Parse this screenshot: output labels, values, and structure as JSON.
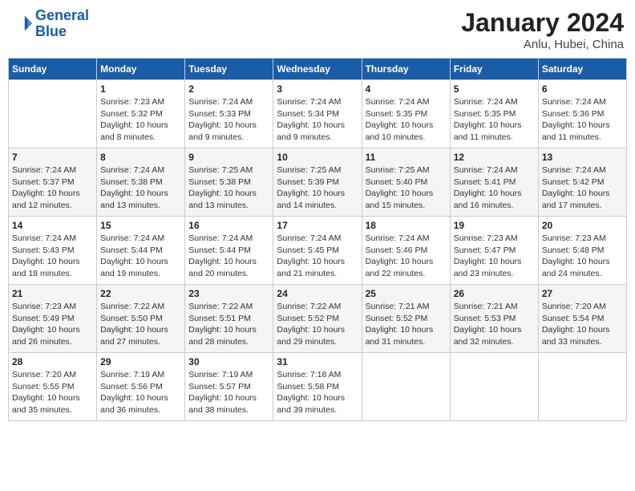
{
  "header": {
    "logo_line1": "General",
    "logo_line2": "Blue",
    "month": "January 2024",
    "location": "Anlu, Hubei, China"
  },
  "days_of_week": [
    "Sunday",
    "Monday",
    "Tuesday",
    "Wednesday",
    "Thursday",
    "Friday",
    "Saturday"
  ],
  "weeks": [
    [
      {
        "num": "",
        "sunrise": "",
        "sunset": "",
        "daylight": ""
      },
      {
        "num": "1",
        "sunrise": "Sunrise: 7:23 AM",
        "sunset": "Sunset: 5:32 PM",
        "daylight": "Daylight: 10 hours and 8 minutes."
      },
      {
        "num": "2",
        "sunrise": "Sunrise: 7:24 AM",
        "sunset": "Sunset: 5:33 PM",
        "daylight": "Daylight: 10 hours and 9 minutes."
      },
      {
        "num": "3",
        "sunrise": "Sunrise: 7:24 AM",
        "sunset": "Sunset: 5:34 PM",
        "daylight": "Daylight: 10 hours and 9 minutes."
      },
      {
        "num": "4",
        "sunrise": "Sunrise: 7:24 AM",
        "sunset": "Sunset: 5:35 PM",
        "daylight": "Daylight: 10 hours and 10 minutes."
      },
      {
        "num": "5",
        "sunrise": "Sunrise: 7:24 AM",
        "sunset": "Sunset: 5:35 PM",
        "daylight": "Daylight: 10 hours and 11 minutes."
      },
      {
        "num": "6",
        "sunrise": "Sunrise: 7:24 AM",
        "sunset": "Sunset: 5:36 PM",
        "daylight": "Daylight: 10 hours and 11 minutes."
      }
    ],
    [
      {
        "num": "7",
        "sunrise": "Sunrise: 7:24 AM",
        "sunset": "Sunset: 5:37 PM",
        "daylight": "Daylight: 10 hours and 12 minutes."
      },
      {
        "num": "8",
        "sunrise": "Sunrise: 7:24 AM",
        "sunset": "Sunset: 5:38 PM",
        "daylight": "Daylight: 10 hours and 13 minutes."
      },
      {
        "num": "9",
        "sunrise": "Sunrise: 7:25 AM",
        "sunset": "Sunset: 5:38 PM",
        "daylight": "Daylight: 10 hours and 13 minutes."
      },
      {
        "num": "10",
        "sunrise": "Sunrise: 7:25 AM",
        "sunset": "Sunset: 5:39 PM",
        "daylight": "Daylight: 10 hours and 14 minutes."
      },
      {
        "num": "11",
        "sunrise": "Sunrise: 7:25 AM",
        "sunset": "Sunset: 5:40 PM",
        "daylight": "Daylight: 10 hours and 15 minutes."
      },
      {
        "num": "12",
        "sunrise": "Sunrise: 7:24 AM",
        "sunset": "Sunset: 5:41 PM",
        "daylight": "Daylight: 10 hours and 16 minutes."
      },
      {
        "num": "13",
        "sunrise": "Sunrise: 7:24 AM",
        "sunset": "Sunset: 5:42 PM",
        "daylight": "Daylight: 10 hours and 17 minutes."
      }
    ],
    [
      {
        "num": "14",
        "sunrise": "Sunrise: 7:24 AM",
        "sunset": "Sunset: 5:43 PM",
        "daylight": "Daylight: 10 hours and 18 minutes."
      },
      {
        "num": "15",
        "sunrise": "Sunrise: 7:24 AM",
        "sunset": "Sunset: 5:44 PM",
        "daylight": "Daylight: 10 hours and 19 minutes."
      },
      {
        "num": "16",
        "sunrise": "Sunrise: 7:24 AM",
        "sunset": "Sunset: 5:44 PM",
        "daylight": "Daylight: 10 hours and 20 minutes."
      },
      {
        "num": "17",
        "sunrise": "Sunrise: 7:24 AM",
        "sunset": "Sunset: 5:45 PM",
        "daylight": "Daylight: 10 hours and 21 minutes."
      },
      {
        "num": "18",
        "sunrise": "Sunrise: 7:24 AM",
        "sunset": "Sunset: 5:46 PM",
        "daylight": "Daylight: 10 hours and 22 minutes."
      },
      {
        "num": "19",
        "sunrise": "Sunrise: 7:23 AM",
        "sunset": "Sunset: 5:47 PM",
        "daylight": "Daylight: 10 hours and 23 minutes."
      },
      {
        "num": "20",
        "sunrise": "Sunrise: 7:23 AM",
        "sunset": "Sunset: 5:48 PM",
        "daylight": "Daylight: 10 hours and 24 minutes."
      }
    ],
    [
      {
        "num": "21",
        "sunrise": "Sunrise: 7:23 AM",
        "sunset": "Sunset: 5:49 PM",
        "daylight": "Daylight: 10 hours and 26 minutes."
      },
      {
        "num": "22",
        "sunrise": "Sunrise: 7:22 AM",
        "sunset": "Sunset: 5:50 PM",
        "daylight": "Daylight: 10 hours and 27 minutes."
      },
      {
        "num": "23",
        "sunrise": "Sunrise: 7:22 AM",
        "sunset": "Sunset: 5:51 PM",
        "daylight": "Daylight: 10 hours and 28 minutes."
      },
      {
        "num": "24",
        "sunrise": "Sunrise: 7:22 AM",
        "sunset": "Sunset: 5:52 PM",
        "daylight": "Daylight: 10 hours and 29 minutes."
      },
      {
        "num": "25",
        "sunrise": "Sunrise: 7:21 AM",
        "sunset": "Sunset: 5:52 PM",
        "daylight": "Daylight: 10 hours and 31 minutes."
      },
      {
        "num": "26",
        "sunrise": "Sunrise: 7:21 AM",
        "sunset": "Sunset: 5:53 PM",
        "daylight": "Daylight: 10 hours and 32 minutes."
      },
      {
        "num": "27",
        "sunrise": "Sunrise: 7:20 AM",
        "sunset": "Sunset: 5:54 PM",
        "daylight": "Daylight: 10 hours and 33 minutes."
      }
    ],
    [
      {
        "num": "28",
        "sunrise": "Sunrise: 7:20 AM",
        "sunset": "Sunset: 5:55 PM",
        "daylight": "Daylight: 10 hours and 35 minutes."
      },
      {
        "num": "29",
        "sunrise": "Sunrise: 7:19 AM",
        "sunset": "Sunset: 5:56 PM",
        "daylight": "Daylight: 10 hours and 36 minutes."
      },
      {
        "num": "30",
        "sunrise": "Sunrise: 7:19 AM",
        "sunset": "Sunset: 5:57 PM",
        "daylight": "Daylight: 10 hours and 38 minutes."
      },
      {
        "num": "31",
        "sunrise": "Sunrise: 7:18 AM",
        "sunset": "Sunset: 5:58 PM",
        "daylight": "Daylight: 10 hours and 39 minutes."
      },
      {
        "num": "",
        "sunrise": "",
        "sunset": "",
        "daylight": ""
      },
      {
        "num": "",
        "sunrise": "",
        "sunset": "",
        "daylight": ""
      },
      {
        "num": "",
        "sunrise": "",
        "sunset": "",
        "daylight": ""
      }
    ]
  ]
}
